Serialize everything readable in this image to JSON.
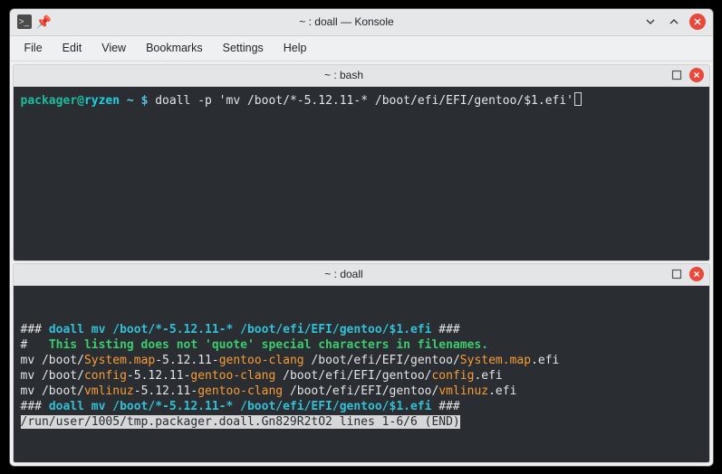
{
  "window": {
    "title": "~ : doall — Konsole",
    "controls": {
      "min": "⌄",
      "max": "⌃",
      "close": "✕"
    },
    "left_icons": {
      "shell_glyph": ">_",
      "pin_glyph": "📌"
    }
  },
  "menubar": {
    "file": "File",
    "edit": "Edit",
    "view": "View",
    "bookmarks": "Bookmarks",
    "settings": "Settings",
    "help": "Help"
  },
  "panes": {
    "top": {
      "title": "~ : bash",
      "prompt": {
        "user": "packager",
        "at": "@",
        "host": "ryzen",
        "cwd": "~",
        "symbol": "$",
        "command": "doall -p 'mv /boot/*-5.12.11-* /boot/efi/EFI/gentoo/$1.efi'"
      }
    },
    "bottom": {
      "title": "~ : doall",
      "lines": {
        "l1_hash": "### ",
        "l1_cmd": "doall mv /boot/*-5.12.11-* /boot/efi/EFI/gentoo/$1.efi",
        "l1_hash2": " ###",
        "l2_hash": "#   ",
        "l2_text": "This listing does not 'quote' special characters in filenames.",
        "l3_a": "mv /boot/",
        "l3_b": "System.map",
        "l3_c": "-5.12.11-",
        "l3_d": "gentoo-clang",
        "l3_e": " /boot/efi/EFI/gentoo/",
        "l3_f": "System.map",
        "l3_g": ".efi",
        "l4_a": "mv /boot/",
        "l4_b": "config",
        "l4_c": "-5.12.11-",
        "l4_d": "gentoo-clang",
        "l4_e": " /boot/efi/EFI/gentoo/",
        "l4_f": "config",
        "l4_g": ".efi",
        "l5_a": "mv /boot/",
        "l5_b": "vmlinuz",
        "l5_c": "-5.12.11-",
        "l5_d": "gentoo-clang",
        "l5_e": " /boot/efi/EFI/gentoo/",
        "l5_f": "vmlinuz",
        "l5_g": ".efi",
        "l6_hash": "### ",
        "l6_cmd": "doall mv /boot/*-5.12.11-* /boot/efi/EFI/gentoo/$1.efi",
        "l6_hash2": " ###",
        "l7_status": "/run/user/1005/tmp.packager.doall.Gn829R2tO2 lines 1-6/6 (END)"
      }
    }
  }
}
